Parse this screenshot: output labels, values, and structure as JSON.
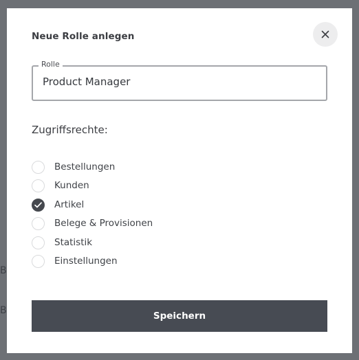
{
  "background": {
    "fragments": [
      "Be",
      "Be"
    ]
  },
  "modal": {
    "title": "Neue Rolle anlegen",
    "close_icon": "close-icon",
    "role_field": {
      "legend": "Rolle",
      "value": "Product Manager"
    },
    "permissions_title": "Zugriffsrechte:",
    "permissions": [
      {
        "label": "Bestellungen",
        "checked": false
      },
      {
        "label": "Kunden",
        "checked": false
      },
      {
        "label": "Artikel",
        "checked": true
      },
      {
        "label": "Belege & Provisionen",
        "checked": false
      },
      {
        "label": "Statistik",
        "checked": false
      },
      {
        "label": "Einstellungen",
        "checked": false
      }
    ],
    "save_label": "Speichern"
  },
  "colors": {
    "overlay": "#6d7075",
    "modal_bg": "#ffffff",
    "primary_button": "#474b53",
    "checked": "#45484e",
    "close_bg": "#ededee"
  }
}
